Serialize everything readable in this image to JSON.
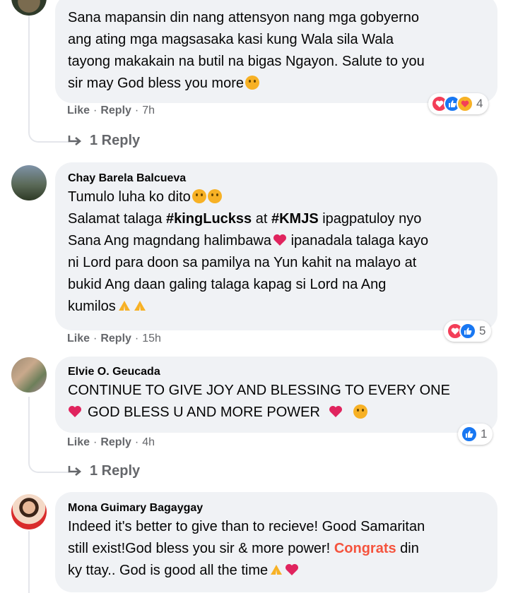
{
  "comments": [
    {
      "author": "",
      "lines": [
        "Sana mapansin din nang attensyon nang mga gobyerno",
        "ang ating mga magsasaka kasi kung Wala sila Wala",
        "tayong makakain na butil na bigas Ngayon. Salute to you",
        "sir may God bless you more"
      ],
      "actions": {
        "like": "Like",
        "reply": "Reply",
        "time": "7h"
      },
      "reaction_count": "4",
      "reply_link": "1 Reply"
    },
    {
      "author": "Chay Barela Balcueva",
      "lines": [
        "Tumulo luha ko dito",
        "Salamat talaga",
        "#kingLuckss",
        "at",
        "#KMJS",
        "ipagpatuloy nyo",
        "Sana Ang magndang halimbawa",
        "ipanadala talaga kayo",
        "ni Lord para doon sa pamilya na Yun kahit na malayo at",
        "bukid Ang daan galing talaga kapag si Lord na Ang",
        "kumilos"
      ],
      "actions": {
        "like": "Like",
        "reply": "Reply",
        "time": "15h"
      },
      "reaction_count": "5"
    },
    {
      "author": "Elvie O. Geucada",
      "lines": [
        "CONTINUE TO GIVE JOY AND BLESSING TO EVERY ONE",
        "GOD BLESS U AND MORE POWER"
      ],
      "actions": {
        "like": "Like",
        "reply": "Reply",
        "time": "4h"
      },
      "reaction_count": "1",
      "reply_link": "1 Reply"
    },
    {
      "author": "Mona Guimary Bagaygay",
      "lines": [
        "Indeed it's better to give than to recieve! Good Samaritan",
        "still exist!God bless you sir & more power!",
        "Congrats",
        "din",
        "ky ttay.. God is good all the time"
      ]
    }
  ],
  "icons": {
    "reactions": [
      "love-reaction-icon",
      "like-reaction-icon",
      "care-reaction-icon"
    ],
    "reply_arrow": "reply-arrow-icon"
  },
  "colors": {
    "bubble": "#f0f2f5",
    "meta": "#65676b",
    "like_blue": "#1877f2",
    "love_red": "#f33e58",
    "congrats": "#f5533d"
  }
}
